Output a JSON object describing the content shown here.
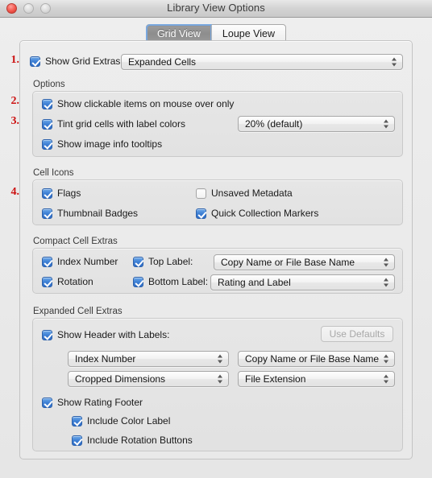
{
  "window": {
    "title": "Library View Options",
    "traffic_lights": [
      "close",
      "minimize",
      "zoom"
    ]
  },
  "tabs": [
    {
      "label": "Grid View",
      "selected": true
    },
    {
      "label": "Loupe View",
      "selected": false
    }
  ],
  "annotations": [
    {
      "text": "1."
    },
    {
      "text": "2."
    },
    {
      "text": "3."
    },
    {
      "text": "4."
    }
  ],
  "grid_extras": {
    "checkbox_label": "Show Grid Extras:",
    "checked": true,
    "popup_value": "Expanded Cells"
  },
  "options": {
    "group_title": "Options",
    "items": [
      {
        "label": "Show clickable items on mouse over only",
        "checked": true
      },
      {
        "label": "Tint grid cells with label colors",
        "checked": true
      },
      {
        "label": "Show image info tooltips",
        "checked": true
      }
    ],
    "tint_popup_value": "20% (default)"
  },
  "cell_icons": {
    "group_title": "Cell Icons",
    "items": [
      {
        "label": "Flags",
        "checked": true
      },
      {
        "label": "Unsaved Metadata",
        "checked": false
      },
      {
        "label": "Thumbnail Badges",
        "checked": true
      },
      {
        "label": "Quick Collection Markers",
        "checked": true
      }
    ]
  },
  "compact_cell_extras": {
    "group_title": "Compact Cell Extras",
    "items": [
      {
        "label": "Index Number",
        "checked": true
      },
      {
        "label": "Rotation",
        "checked": true
      },
      {
        "label": "Top Label:",
        "checked": true
      },
      {
        "label": "Bottom Label:",
        "checked": true
      }
    ],
    "top_label_value": "Copy Name or File Base Name",
    "bottom_label_value": "Rating and Label"
  },
  "expanded_cell_extras": {
    "group_title": "Expanded Cell Extras",
    "header_checkbox_label": "Show Header with Labels:",
    "header_checked": true,
    "use_defaults_label": "Use Defaults",
    "popups": [
      "Index Number",
      "Copy Name or File Base Name",
      "Cropped Dimensions",
      "File Extension"
    ],
    "rating_footer": {
      "label": "Show Rating Footer",
      "checked": true
    },
    "sub_items": [
      {
        "label": "Include Color Label",
        "checked": true
      },
      {
        "label": "Include Rotation Buttons",
        "checked": true
      }
    ]
  },
  "colors": {
    "accent_blue": "#3d7fd4",
    "annotation_red": "#cc1111",
    "window_bg": "#ececec"
  }
}
